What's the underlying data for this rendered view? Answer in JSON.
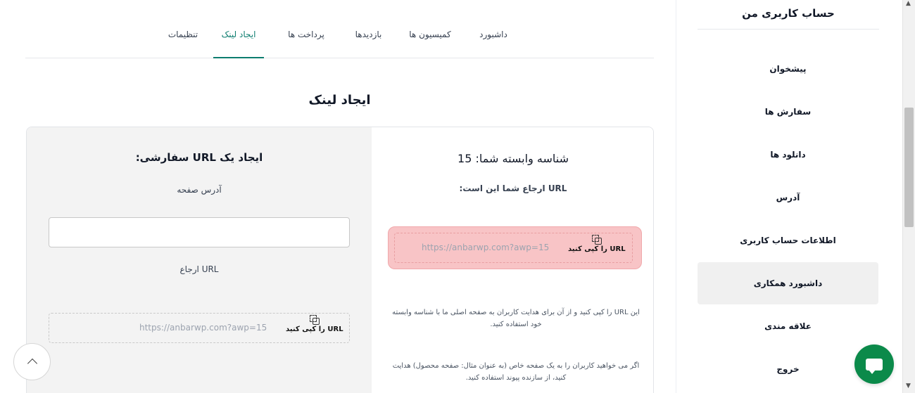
{
  "sidebar": {
    "title": "حساب کاربری من",
    "items": [
      {
        "label": "پیشخوان"
      },
      {
        "label": "سفارش ها"
      },
      {
        "label": "دانلود ها"
      },
      {
        "label": "آدرس"
      },
      {
        "label": "اطلاعات حساب کاربری"
      },
      {
        "label": "داشبورد همکاری",
        "active": true
      },
      {
        "label": "علاقه مندی"
      },
      {
        "label": "خروج"
      }
    ]
  },
  "tabs": [
    {
      "label": "داشبورد"
    },
    {
      "label": "کمیسیون ها"
    },
    {
      "label": "بازدیدها"
    },
    {
      "label": "پرداخت ها"
    },
    {
      "label": "ایجاد لینک",
      "active": true
    },
    {
      "label": "تنظیمات"
    }
  ],
  "section_title": "ایجاد لینک",
  "left_panel": {
    "heading": "ایجاد یک URL سفارشی:",
    "page_address_label": "آدرس صفحه",
    "page_address_value": "",
    "referral_url_label": "URL ارجاع",
    "generated_url": "https://anbarwp.com?awp=15",
    "copy_label": "URL را کپی کنید"
  },
  "right_panel": {
    "affiliate_id_label": "شناسه وابسته شما: 15",
    "referral_url_label": "URL ارجاع شما این است:",
    "referral_url": "https://anbarwp.com?awp=15",
    "copy_label": "URL را کپی کنید",
    "note_1": "این URL را کپی کنید و از آن برای هدایت کاربران به صفحه اصلی ما با شناسه وابسته خود استفاده کنید.",
    "note_2": "اگر می خواهید کاربران را به یک صفحه خاص (به عنوان مثال: صفحه محصول) هدایت کنید، از سازنده پیوند استفاده کنید."
  },
  "colors": {
    "accent": "#0d7d6f",
    "highlight_bg": "#f8c4c6",
    "chat_button": "#0b8a4a"
  },
  "icons": {
    "copy": "copy-icon",
    "back_to_top": "chevron-up-icon",
    "chat": "chat-icon"
  }
}
